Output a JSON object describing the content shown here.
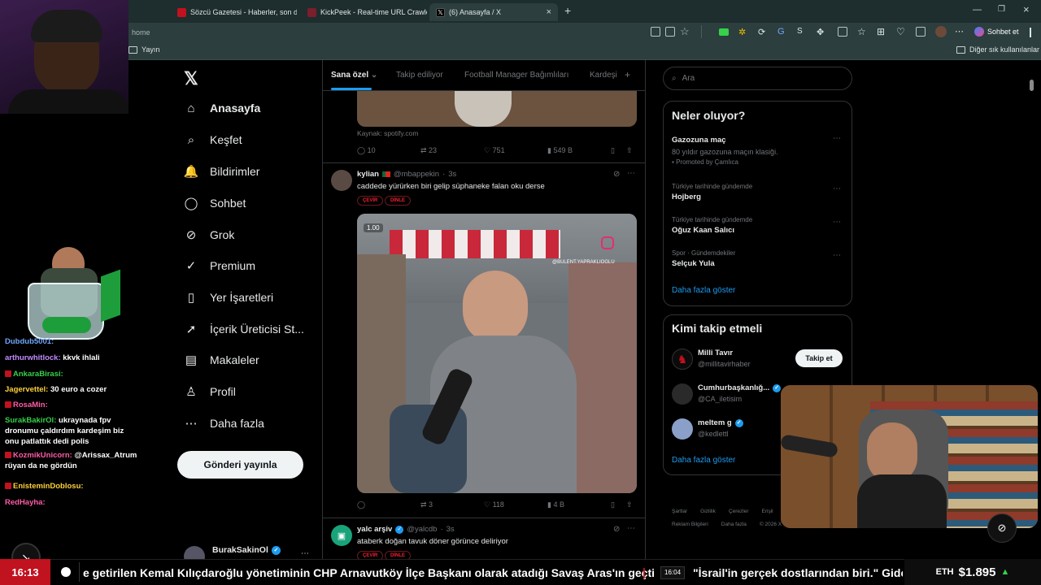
{
  "browser": {
    "tabs": [
      {
        "title": "Sözcü Gazetesi - Haberler, son da",
        "color": "#c1121f"
      },
      {
        "title": "KickPeek - Real-time URL Crawler",
        "color": "#7a1f2b"
      },
      {
        "title": "(6) Anasayfa / X",
        "color": "#000000"
      }
    ],
    "url": "home",
    "bookmark_left": "Yayın",
    "bookmark_right": "Diğer sık kullanılanlar",
    "chat_button": "Sohbet et"
  },
  "sidebar": {
    "items": [
      {
        "label": "Anasayfa",
        "icon": "home-icon",
        "glyph": "⌂"
      },
      {
        "label": "Keşfet",
        "icon": "search-icon",
        "glyph": "⌕"
      },
      {
        "label": "Bildirimler",
        "icon": "bell-icon",
        "glyph": "🔔"
      },
      {
        "label": "Sohbet",
        "icon": "chat-icon",
        "glyph": "◯"
      },
      {
        "label": "Grok",
        "icon": "grok-icon",
        "glyph": "⊘"
      },
      {
        "label": "Premium",
        "icon": "premium-icon",
        "glyph": "✓"
      },
      {
        "label": "Yer İşaretleri",
        "icon": "bookmark-icon",
        "glyph": "▯"
      },
      {
        "label": "İçerik Üreticisi St...",
        "icon": "rocket-icon",
        "glyph": "➚"
      },
      {
        "label": "Makaleler",
        "icon": "article-icon",
        "glyph": "▤"
      },
      {
        "label": "Profil",
        "icon": "profile-icon",
        "glyph": "♙"
      },
      {
        "label": "Daha fazla",
        "icon": "more-icon",
        "glyph": "⋯"
      }
    ],
    "post_button": "Gönderi yayınla",
    "account_name": "BurakSakinOl"
  },
  "feed": {
    "tabs": [
      "Sana özel",
      "Takip ediliyor",
      "Football Manager Bağımlıları",
      "Kardeşi"
    ],
    "post0": {
      "source": "Kaynak: spotify.com",
      "replies": "10",
      "reposts": "23",
      "likes": "751",
      "views": "549 B"
    },
    "post1": {
      "name": "kylian",
      "handle": "@mbappekin",
      "time": "3s",
      "text": "caddede yürürken biri gelip süphaneke falan oku derse",
      "translate": "ÇEVİR",
      "listen": "DİNLE",
      "video_tag": "1.00",
      "watermark": "@BULENT.YAPRAKLIOGLU",
      "replies": "",
      "reposts": "3",
      "likes": "118",
      "views": "4 B"
    },
    "post2": {
      "name": "yalc arşiv",
      "handle": "@yalcdb",
      "time": "3s",
      "text": "ataberk doğan tavuk döner görünce deliriyor",
      "translate": "ÇEVİR",
      "listen": "DİNLE"
    }
  },
  "right": {
    "search_placeholder": "Ara",
    "trends_title": "Neler oluyor?",
    "trends": [
      {
        "meta": "",
        "name": "Gazozuna maç",
        "sub": "80 yıldır gazozuna maçın klasiği.",
        "promo": "Promoted by Çamlıca"
      },
      {
        "meta": "Türkiye tarihinde gündemde",
        "name": "Hojberg"
      },
      {
        "meta": "Türkiye tarihinde gündemde",
        "name": "Oğuz Kaan Salıcı"
      },
      {
        "meta": "Spor · Gündemdekiler",
        "name": "Selçuk Yula"
      }
    ],
    "show_more": "Daha fazla göster",
    "follow_title": "Kimi takip etmeli",
    "follow": [
      {
        "name": "Milli Tavır",
        "handle": "@millitavirhaber",
        "button": "Takip et"
      },
      {
        "name": "Cumhurbaşkanlığ...",
        "handle": "@CA_iletisim"
      },
      {
        "name": "meltem g",
        "handle": "@kedlettl"
      }
    ],
    "follow_more": "Daha fazla göster",
    "footer1": [
      "Şartlar",
      "Gizlilik",
      "Çerezler",
      "Erişil"
    ],
    "footer2": [
      "Reklam Bilgileri",
      "Daha fazla",
      "© 2026 X C"
    ]
  },
  "chat": [
    {
      "user": "Dubdub5001:",
      "msg": "",
      "color": "#6fa8ff",
      "badge": false
    },
    {
      "user": "arthurwhitlock:",
      "msg": "kkvk ihlali",
      "color": "#c28bff",
      "badge": false
    },
    {
      "user": "AnkaraBirasi:",
      "msg": "",
      "color": "#35d24a",
      "badge": true
    },
    {
      "user": "Jagervettel:",
      "msg": "30 euro a cozer",
      "color": "#ffd13a",
      "badge": false
    },
    {
      "user": "RosaMin:",
      "msg": "",
      "color": "#ff5ca8",
      "badge": true
    },
    {
      "user": "SurakBakirOl:",
      "msg": "ukraynada fpv dronumu çaldırdım kardeşim biz onu patlattık dedi polis",
      "color": "#35d24a",
      "badge": false
    },
    {
      "user": "KozmikUnicorn:",
      "msg": "@Arissax_Atrum rüyan da ne gördün",
      "color": "#ff5ca8",
      "badge": true
    },
    {
      "user": "EnisteminDoblosu:",
      "msg": "",
      "color": "#ffd13a",
      "badge": true
    },
    {
      "user": "RedHayha:",
      "msg": "",
      "color": "#ff5ca8",
      "badge": false
    }
  ],
  "ticker": {
    "time": "16:13",
    "headline": "e getirilen Kemal Kılıçdaroğlu yönetiminin CHP Arnavutköy İlçe Başkanı olarak atadığı Savaş Aras'ın geçti",
    "stamp": "16:04",
    "headline2": "\"İsrail'in gerçek dostlarından biri.\" Gideo",
    "eth_label": "ETH",
    "eth_value": "$1.895"
  }
}
